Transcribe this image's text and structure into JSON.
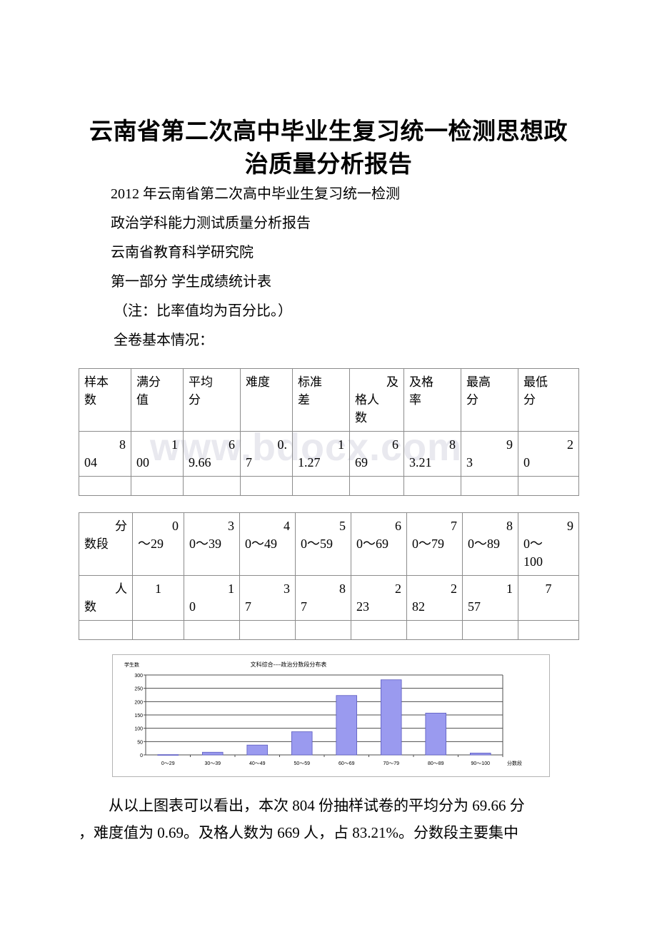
{
  "document": {
    "title": "云南省第二次高中毕业生复习统一检测思想政治质量分析报告",
    "watermark": "www.bdocx.com",
    "lines": [
      "2012 年云南省第二次高中毕业生复习统一检测",
      "政治学科能力测试质量分析报告",
      "云南省教育科学研究院",
      "第一部分 学生成绩统计表",
      "（注：比率值均为百分比。）",
      "全卷基本情况："
    ],
    "footer_lines": [
      "从以上图表可以看出，本次 804 份抽样试卷的平均分为 69.66 分",
      "，难度值为 0.69。及格人数为 669 人，占 83.21%。分数段主要集中"
    ]
  },
  "table_overall": {
    "headers": [
      {
        "l1": "样本",
        "l2": "数"
      },
      {
        "l1": "满分",
        "l2": "值"
      },
      {
        "l1": "平均",
        "l2": "分"
      },
      {
        "l1": "",
        "l2": "难度"
      },
      {
        "l1": "标准",
        "l2": "差"
      },
      {
        "l0": "及",
        "l1": "格人",
        "l2": "数"
      },
      {
        "l1": "及格",
        "l2": "率"
      },
      {
        "l1": "最高",
        "l2": "分"
      },
      {
        "l1": "最低",
        "l2": "分"
      }
    ],
    "values": [
      {
        "l1": "8",
        "l2": "04",
        "full": "804"
      },
      {
        "l1": "1",
        "l2": "00",
        "full": "100"
      },
      {
        "l1": "6",
        "l2": "9.66",
        "full": "69.66"
      },
      {
        "l1": "0.",
        "l2": "7",
        "full": "0.7"
      },
      {
        "l1": "1",
        "l2": "1.27",
        "full": "11.27"
      },
      {
        "l1": "6",
        "l2": "69",
        "full": "669"
      },
      {
        "l1": "8",
        "l2": "3.21",
        "full": "83.21"
      },
      {
        "l1": "9",
        "l2": "3",
        "full": "93"
      },
      {
        "l1": "2",
        "l2": "0",
        "full": "20"
      }
    ]
  },
  "table_bands": {
    "row_label_1": {
      "l1": "分",
      "l2": "数段"
    },
    "row_label_2": {
      "l1": "人",
      "l2": "数"
    },
    "bands": [
      {
        "l1": "0",
        "l2": "～29",
        "full": "0～29"
      },
      {
        "l1": "3",
        "l2": "0～39",
        "full": "30～39"
      },
      {
        "l1": "4",
        "l2": "0～49",
        "full": "40～49"
      },
      {
        "l1": "5",
        "l2": "0～59",
        "full": "50～59"
      },
      {
        "l1": "6",
        "l2": "0～69",
        "full": "60～69"
      },
      {
        "l1": "7",
        "l2": "0～79",
        "full": "70～79"
      },
      {
        "l1": "8",
        "l2": "0～89",
        "full": "80～89"
      },
      {
        "l1": "9",
        "l2": "0～",
        "l3": "100",
        "full": "90～100"
      }
    ],
    "counts": [
      {
        "l1": "",
        "l2": "1",
        "full": "1"
      },
      {
        "l1": "1",
        "l2": "0",
        "full": "10"
      },
      {
        "l1": "3",
        "l2": "7",
        "full": "37"
      },
      {
        "l1": "8",
        "l2": "7",
        "full": "87"
      },
      {
        "l1": "2",
        "l2": "23",
        "full": "223"
      },
      {
        "l1": "2",
        "l2": "82",
        "full": "282"
      },
      {
        "l1": "1",
        "l2": "57",
        "full": "157"
      },
      {
        "l1": "",
        "l2": "7",
        "full": "7"
      }
    ]
  },
  "chart_data": {
    "type": "bar",
    "title": "文科综合----政治分数段分布表",
    "xlabel": "分数段",
    "ylabel": "学生数",
    "categories": [
      "0～29",
      "30～39",
      "40～49",
      "50～59",
      "60～69",
      "70～79",
      "80～89",
      "90～100"
    ],
    "values": [
      1,
      10,
      37,
      87,
      223,
      282,
      157,
      7
    ],
    "yticks": [
      0,
      50,
      100,
      150,
      200,
      250,
      300
    ],
    "ylim": [
      0,
      300
    ],
    "grid": true,
    "legend": "none",
    "bar_color": "#9a9aef",
    "bar_edge_color": "#5c5cc0",
    "grid_color": "#4d4d4d",
    "axis_color": "#4d4d4d"
  }
}
